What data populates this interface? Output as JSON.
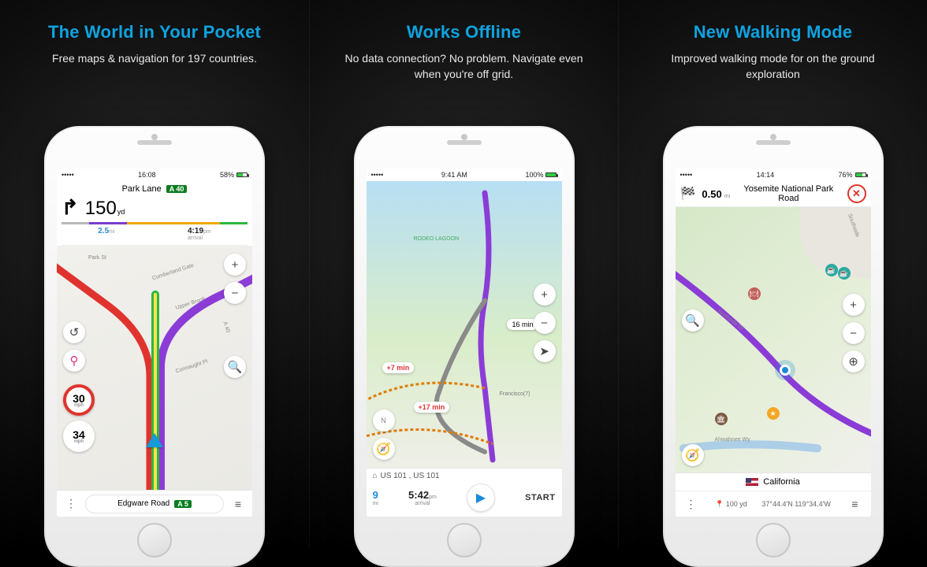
{
  "panels": [
    {
      "headline": "The World in Your Pocket",
      "subhead": "Free maps & navigation for 197 countries.",
      "status": {
        "time": "16:08",
        "battery": "58%"
      },
      "nav": {
        "street": "Park Lane",
        "roadBadge": "A 40",
        "turnDistValue": "150",
        "turnDistUnit": "yd",
        "remainingDist": "2.5",
        "remainingDistUnit": "mi",
        "eta": "4:19",
        "etaAmPm": "pm",
        "etaLabel": "arrival"
      },
      "speed": {
        "limitValue": "30",
        "limitUnit": "mph",
        "currentValue": "34",
        "currentUnit": "mph"
      },
      "bottom": {
        "road": "Edgware Road",
        "roadBadge": "A 5"
      }
    },
    {
      "headline": "Works Offline",
      "subhead": "No data connection? No problem. Navigate even when you're off grid.",
      "status": {
        "time": "9:41 AM",
        "battery": "100%"
      },
      "etas": {
        "main": "16 min",
        "alt1": "+7 min",
        "alt2": "+17 min"
      },
      "mapLabels": {
        "rodeo": "RODEO LAGOON",
        "sf": "Francisco(7)"
      },
      "bottom": {
        "routeName": "US 101 , US 101",
        "distValue": "9",
        "distUnit": "mi",
        "etaValue": "5:42",
        "etaAmPm": "pm",
        "etaLabel": "arrival",
        "startLabel": "START"
      }
    },
    {
      "headline": "New Walking Mode",
      "subhead": "Improved walking mode for on the ground exploration",
      "status": {
        "time": "14:14",
        "battery": "76%"
      },
      "top": {
        "distValue": "0.50",
        "distUnit": "mi",
        "destination": "Yosemite National Park Road"
      },
      "mapLabels": {
        "road": "Northside Dr",
        "river": "Ahwahnee Wy",
        "area": "Southside"
      },
      "bottom": {
        "region": "California",
        "yards": "100 yd",
        "coords": "37°44.4'N   119°34.4'W"
      }
    }
  ]
}
